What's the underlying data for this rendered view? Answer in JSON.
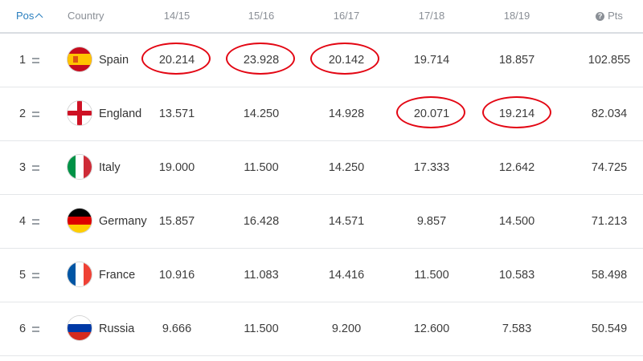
{
  "header": {
    "pos": "Pos",
    "country": "Country",
    "seasons": [
      "14/15",
      "15/16",
      "16/17",
      "17/18",
      "18/19"
    ],
    "pts": "Pts"
  },
  "rows": [
    {
      "pos": "1",
      "country": "Spain",
      "values": [
        "20.214",
        "23.928",
        "20.142",
        "19.714",
        "18.857"
      ],
      "pts": "102.855",
      "flag": "spain-flag-icon"
    },
    {
      "pos": "2",
      "country": "England",
      "values": [
        "13.571",
        "14.250",
        "14.928",
        "20.071",
        "19.214"
      ],
      "pts": "82.034",
      "flag": "england-flag-icon"
    },
    {
      "pos": "3",
      "country": "Italy",
      "values": [
        "19.000",
        "11.500",
        "14.250",
        "17.333",
        "12.642"
      ],
      "pts": "74.725",
      "flag": "italy-flag-icon"
    },
    {
      "pos": "4",
      "country": "Germany",
      "values": [
        "15.857",
        "16.428",
        "14.571",
        "9.857",
        "14.500"
      ],
      "pts": "71.213",
      "flag": "germany-flag-icon"
    },
    {
      "pos": "5",
      "country": "France",
      "values": [
        "10.916",
        "11.083",
        "14.416",
        "11.500",
        "10.583"
      ],
      "pts": "58.498",
      "flag": "france-flag-icon"
    },
    {
      "pos": "6",
      "country": "Russia",
      "values": [
        "9.666",
        "11.500",
        "9.200",
        "12.600",
        "7.583"
      ],
      "pts": "50.549",
      "flag": "russia-flag-icon"
    }
  ],
  "highlight_color": "#e30613",
  "accent_color": "#2a7fbf"
}
